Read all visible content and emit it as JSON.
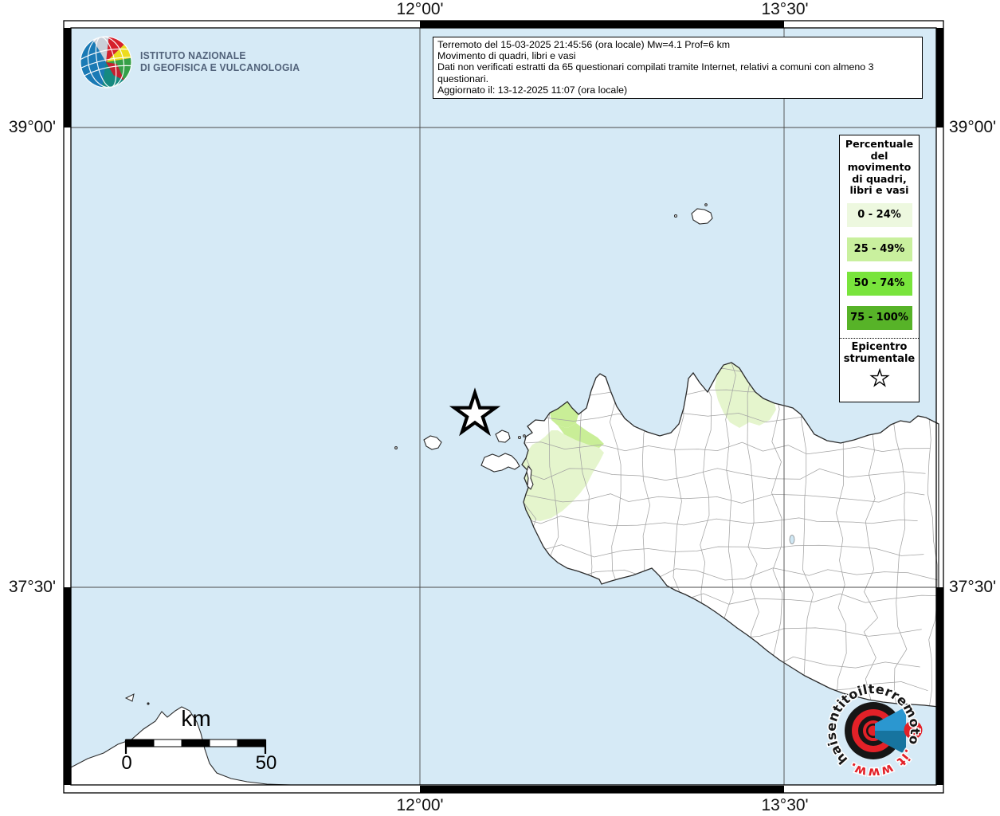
{
  "header": {
    "ingv_line1": "ISTITUTO NAZIONALE",
    "ingv_line2": "DI GEOFISICA E VULCANOLOGIA",
    "info_lines": [
      "Terremoto del 15-03-2025 21:45:56 (ora locale) Mw=4.1 Prof=6 km",
      "Movimento di quadri, libri e vasi",
      "Dati non verificati estratti da 65 questionari compilati tramite Internet, relativi a comuni con almeno 3 questionari.",
      "Aggiornato il: 13-12-2025 11:07 (ora locale)"
    ]
  },
  "axes": {
    "top": [
      "12°00'",
      "13°30'"
    ],
    "bottom": [
      "12°00'",
      "13°30'"
    ],
    "left": [
      "39°00'",
      "37°30'"
    ],
    "right": [
      "39°00'",
      "37°30'"
    ]
  },
  "legend": {
    "title_lines": [
      "Percentuale",
      "del",
      "movimento",
      "di quadri,",
      "libri e vasi"
    ],
    "items": [
      {
        "label": "0 - 24%",
        "color": "#edf8df"
      },
      {
        "label": "25 - 49%",
        "color": "#c9f09e"
      },
      {
        "label": "50 - 74%",
        "color": "#79e43c"
      },
      {
        "label": "75 - 100%",
        "color": "#57b328"
      }
    ],
    "epicenter_line1": "Epicentro",
    "epicenter_line2": "strumentale"
  },
  "scalebar": {
    "unit": "km",
    "start": "0",
    "end": "50"
  },
  "watermark": {
    "prefix": "www.",
    "body": "haisentitoilterremoto",
    "suffix": ".it",
    "question": "?"
  },
  "map": {
    "sea_color": "#d6eaf6",
    "land_color": "#ffffff",
    "shade_low": "#e5f5cd",
    "shade_mid": "#c9ee97",
    "accent_red": "#e32128",
    "accent_blue": "#2b97d0"
  }
}
